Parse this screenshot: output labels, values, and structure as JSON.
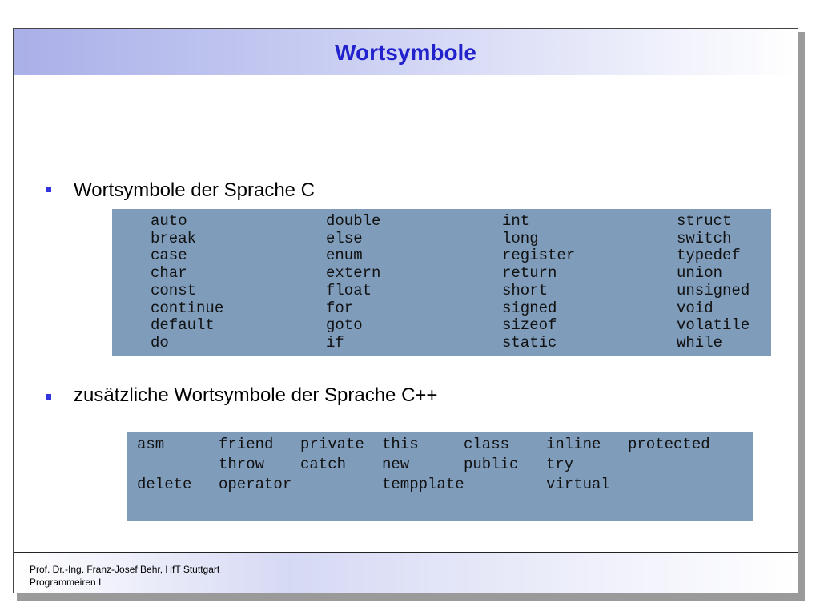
{
  "slide": {
    "title": "Wortsymbole",
    "section_c": {
      "heading": "Wortsymbole  der Sprache C",
      "columns": [
        [
          "auto",
          "break",
          "case",
          "char",
          "const",
          "continue",
          "default",
          "do"
        ],
        [
          "double",
          "else",
          "enum",
          "extern",
          "float",
          "for",
          "goto",
          "if"
        ],
        [
          "int",
          "long",
          "register",
          "return",
          "short",
          "signed",
          "sizeof",
          "static"
        ],
        [
          "struct",
          "switch",
          "typedef",
          "union",
          "unsigned",
          "void",
          "volatile",
          "while"
        ]
      ]
    },
    "section_cpp": {
      "heading": "zusätzliche Wortsymbole  der Sprache C++",
      "rows": [
        [
          "asm",
          "friend",
          "private",
          "this",
          "class",
          "inline",
          "protected"
        ],
        [
          "",
          "throw",
          "catch",
          "new",
          "public",
          "try",
          ""
        ],
        [
          "delete",
          "operator",
          "",
          "tempplate",
          "",
          "virtual",
          ""
        ]
      ]
    },
    "footer": {
      "line1": "Prof. Dr.-Ing. Franz-Josef Behr, HfT Stuttgart",
      "line2": "Programmeiren I"
    }
  },
  "colors": {
    "title": "#2222cc",
    "code_background": "#7f9cbb",
    "bullet": "#3333dd"
  }
}
